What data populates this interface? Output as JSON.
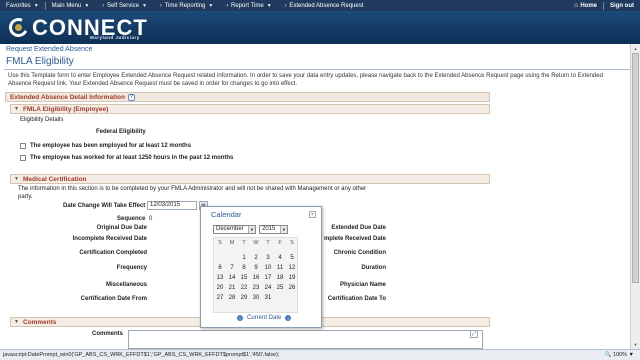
{
  "topnav": {
    "favorites": "Favorites",
    "main_menu": "Main Menu",
    "crumbs": [
      "Self Service",
      "Time Reporting",
      "Report Time",
      "Extended Absence Request"
    ],
    "home": "Home",
    "signout": "Sign out"
  },
  "banner": {
    "logo_text": "CONNECT",
    "logo_sub": "Maryland Judiciary"
  },
  "page": {
    "crumb": "Request Extended Absence",
    "title": "FMLA Eligibility",
    "instructions": "Use this Template form to enter Employee Extended Absence Request related information. In order to save your data entry updates, please navigate back to the Extended Absence Request page using the Return to Extended Absence Request link.  Your Extended Absence Request must be saved in order for changes to go into effect."
  },
  "section": {
    "title": "Extended Absence Detail Information",
    "help": "?"
  },
  "fmla": {
    "title": "FMLA Eligibility (Employee)",
    "details_label": "Eligibility Details",
    "federal_label": "Federal Eligibility",
    "check1": "The employee has been employed for at least 12 months",
    "check2": "The employee has worked for at least 1250 hours in the past 12 months"
  },
  "medical": {
    "title": "Medical Certification",
    "info": "The information in this section is to be completed by your FMLA Administrator and will not be shared with Management or any other party.",
    "date_change_label": "Date Change Will Take Effect",
    "date_change_value": "12/03/2015",
    "sequence_label": "Sequence",
    "sequence_value": "0",
    "left_labels": [
      "Original Due Date",
      "Incomplete Received Date",
      "Certification Completed",
      "Frequency",
      "Miscellaneous",
      "Certification Date From"
    ],
    "right_labels": [
      "Extended Due Date",
      "mplete Received Date",
      "Chronic Condition",
      "Duration",
      "Physician Name",
      "Certification Date To"
    ]
  },
  "calendar": {
    "title": "Calendar",
    "month": "December",
    "year": "2015",
    "dow": [
      "S",
      "M",
      "T",
      "W",
      "T",
      "F",
      "S"
    ],
    "days": [
      "1",
      "2",
      "3",
      "4",
      "5",
      "6",
      "7",
      "8",
      "9",
      "10",
      "11",
      "12",
      "13",
      "14",
      "15",
      "16",
      "17",
      "18",
      "19",
      "20",
      "21",
      "22",
      "23",
      "24",
      "25",
      "26",
      "27",
      "28",
      "29",
      "30",
      "31"
    ],
    "current_date": "Current Date"
  },
  "comments": {
    "title": "Comments",
    "label": "Comments"
  },
  "status": {
    "text": "javascript:DatePrompt_win0('GP_ABS_CS_WRK_EFFDT$1','GP_ABS_CS_WRK_EFFDT$prompt$1','450',false);",
    "zoom": "100%"
  }
}
